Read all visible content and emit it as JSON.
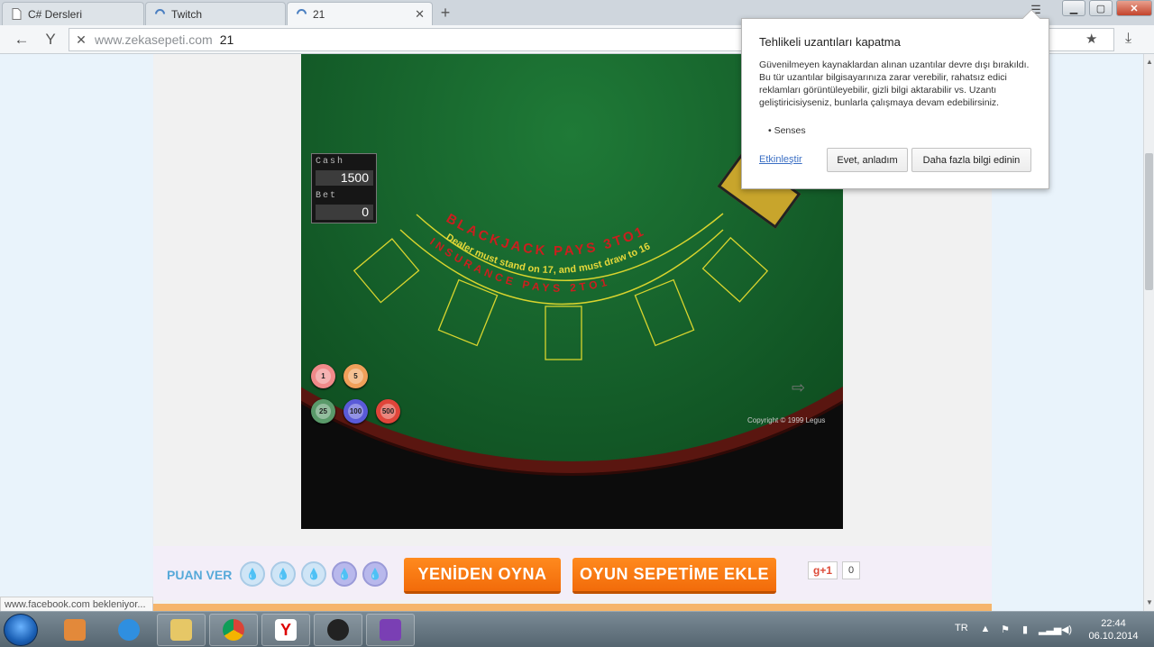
{
  "tabs": [
    {
      "label": "C# Dersleri",
      "icon": "document-icon"
    },
    {
      "label": "Twitch",
      "icon": "loading-icon"
    },
    {
      "label": "21",
      "icon": "loading-icon",
      "active": true
    }
  ],
  "address_bar": {
    "host": "www.zekasepeti.com",
    "path": "21"
  },
  "game": {
    "cash_label": "Cash",
    "cash_value": "1500",
    "bet_label": "Bet",
    "bet_value": "0",
    "table_text_1": "BLACKJACK PAYS 3TO1",
    "table_text_2": "Dealer must stand on 17, and must draw to 16",
    "table_text_3": "INSURANCE PAYS 2TO1",
    "chips": [
      "1",
      "5",
      "25",
      "100",
      "500"
    ],
    "copyright": "Copyright © 1999 Legus"
  },
  "rating": {
    "label": "PUAN VER"
  },
  "buttons": {
    "replay": "YENİDEN OYNA",
    "add_to_basket": "OYUN SEPETİME EKLE"
  },
  "gplus": {
    "label": "g+1",
    "count": "0"
  },
  "status_bar": "www.facebook.com bekleniyor...",
  "notification": {
    "title": "Tehlikeli uzantıları kapatma",
    "body": "Güvenilmeyen kaynaklardan alınan uzantılar devre dışı bırakıldı. Bu tür uzantılar bilgisayarınıza zarar verebilir, rahatsız edici reklamları görüntüleyebilir, gizli bilgi aktarabilir vs. Uzantı geliştiricisiyseniz, bunlarla çalışmaya devam edebilirsiniz.",
    "item": "• Senses",
    "enable_link": "Etkinleştir",
    "ok_button": "Evet, anladım",
    "more_button": "Daha fazla bilgi edinin"
  },
  "taskbar": {
    "lang": "TR",
    "time": "22:44",
    "date": "06.10.2014"
  },
  "colors": {
    "felt": "#155f2a",
    "accent_orange": "#f26b0a",
    "rating_blue": "#56a9d9"
  }
}
